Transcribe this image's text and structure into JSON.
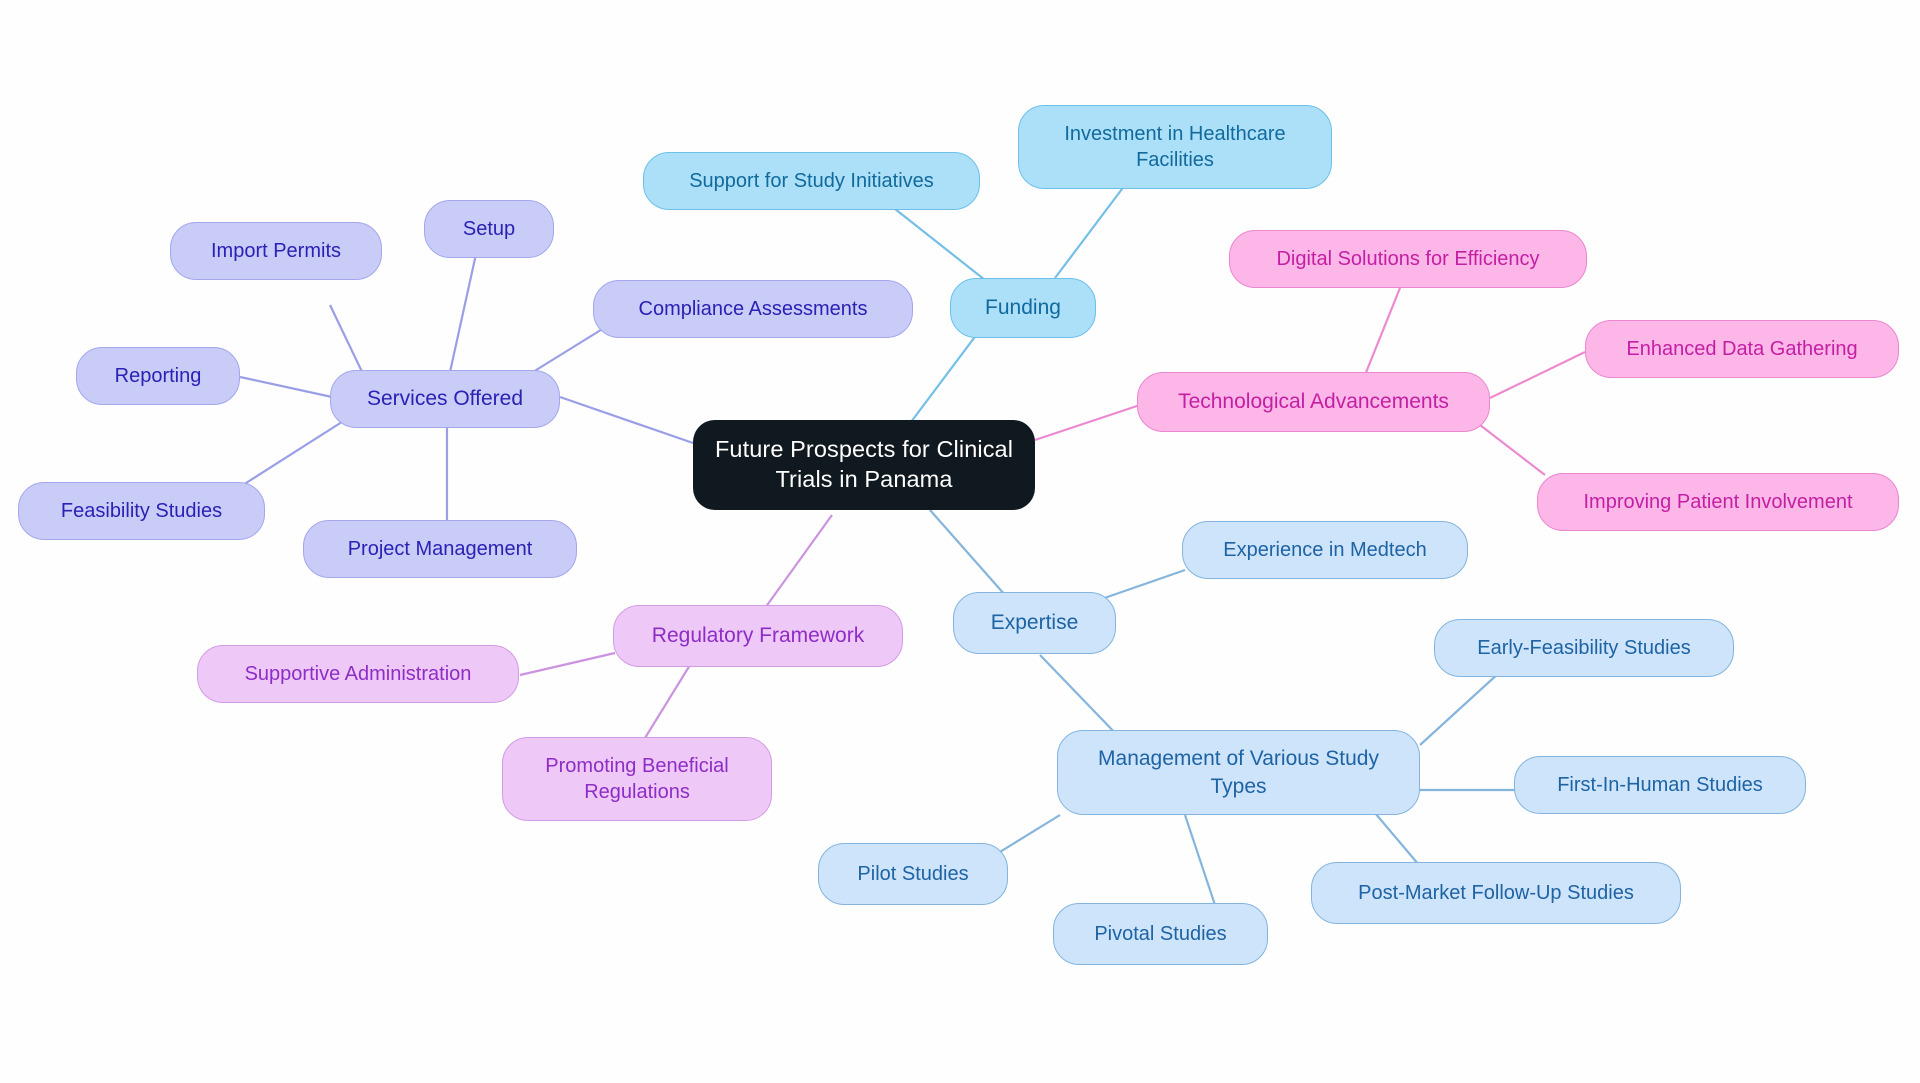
{
  "diagram": {
    "type": "mindmap",
    "title": "Future Prospects for Clinical Trials in Panama",
    "background_color": "#fefeff",
    "root": {
      "id": "root",
      "label": "Future Prospects for Clinical\nTrials in Panama",
      "fill": "#101820",
      "text_color": "#ffffff"
    },
    "branches": [
      {
        "id": "services-offered",
        "label": "Services Offered",
        "color_key": "indigo",
        "fill": "#c9ccf7",
        "border": "#a3a7ec",
        "text_color": "#2a21b5",
        "children": [
          {
            "id": "import-permits",
            "label": "Import Permits"
          },
          {
            "id": "setup",
            "label": "Setup"
          },
          {
            "id": "reporting",
            "label": "Reporting"
          },
          {
            "id": "compliance-assessments",
            "label": "Compliance Assessments"
          },
          {
            "id": "feasibility-studies",
            "label": "Feasibility Studies"
          },
          {
            "id": "project-management",
            "label": "Project Management"
          }
        ]
      },
      {
        "id": "funding",
        "label": "Funding",
        "color_key": "sky",
        "fill": "#ace0f9",
        "border": "#6cc0e8",
        "text_color": "#116a9b",
        "children": [
          {
            "id": "support-for-study-initiatives",
            "label": "Support for Study Initiatives"
          },
          {
            "id": "investment-in-healthcare-facilities",
            "label": "Investment in Healthcare\nFacilities"
          }
        ]
      },
      {
        "id": "technological-advancements",
        "label": "Technological Advancements",
        "color_key": "pink",
        "fill": "#fcb6e8",
        "border": "#ec86cf",
        "text_color": "#c41fa3",
        "children": [
          {
            "id": "digital-solutions-for-efficiency",
            "label": "Digital Solutions for Efficiency"
          },
          {
            "id": "enhanced-data-gathering",
            "label": "Enhanced Data Gathering"
          },
          {
            "id": "improving-patient-involvement",
            "label": "Improving Patient Involvement"
          }
        ]
      },
      {
        "id": "regulatory-framework",
        "label": "Regulatory Framework",
        "color_key": "violet",
        "fill": "#eec8f7",
        "border": "#d49be5",
        "text_color": "#8e2dc6",
        "children": [
          {
            "id": "supportive-administration",
            "label": "Supportive Administration"
          },
          {
            "id": "promoting-beneficial-regulations",
            "label": "Promoting Beneficial\nRegulations"
          }
        ]
      },
      {
        "id": "expertise",
        "label": "Expertise",
        "color_key": "paleblue",
        "fill": "#cde4fa",
        "border": "#84b4dd",
        "text_color": "#1e63a4",
        "children": [
          {
            "id": "experience-in-medtech",
            "label": "Experience in Medtech"
          },
          {
            "id": "management-of-various-study-types",
            "label": "Management of Various Study\nTypes",
            "children": [
              {
                "id": "early-feasibility-studies",
                "label": "Early-Feasibility Studies"
              },
              {
                "id": "first-in-human-studies",
                "label": "First-In-Human Studies"
              },
              {
                "id": "post-market-follow-up-studies",
                "label": "Post-Market Follow-Up Studies"
              },
              {
                "id": "pivotal-studies",
                "label": "Pivotal Studies"
              },
              {
                "id": "pilot-studies",
                "label": "Pilot Studies"
              }
            ]
          }
        ]
      }
    ],
    "nodes": {
      "root": {
        "label": "Future Prospects for Clinical\nTrials in Panama"
      },
      "services_offered": {
        "label": "Services Offered"
      },
      "import_permits": {
        "label": "Import Permits"
      },
      "setup": {
        "label": "Setup"
      },
      "reporting": {
        "label": "Reporting"
      },
      "compliance_assessments": {
        "label": "Compliance Assessments"
      },
      "feasibility_studies": {
        "label": "Feasibility Studies"
      },
      "project_management": {
        "label": "Project Management"
      },
      "funding": {
        "label": "Funding"
      },
      "support_for_study_initiatives": {
        "label": "Support for Study Initiatives"
      },
      "investment_in_healthcare_facilities": {
        "label": "Investment in Healthcare\nFacilities"
      },
      "technological_advancements": {
        "label": "Technological Advancements"
      },
      "digital_solutions_for_efficiency": {
        "label": "Digital Solutions for Efficiency"
      },
      "enhanced_data_gathering": {
        "label": "Enhanced Data Gathering"
      },
      "improving_patient_involvement": {
        "label": "Improving Patient Involvement"
      },
      "regulatory_framework": {
        "label": "Regulatory Framework"
      },
      "supportive_administration": {
        "label": "Supportive Administration"
      },
      "promoting_beneficial_regulations": {
        "label": "Promoting Beneficial\nRegulations"
      },
      "expertise": {
        "label": "Expertise"
      },
      "experience_in_medtech": {
        "label": "Experience in Medtech"
      },
      "management_of_various_study_types": {
        "label": "Management of Various Study\nTypes"
      },
      "early_feasibility_studies": {
        "label": "Early-Feasibility Studies"
      },
      "first_in_human_studies": {
        "label": "First-In-Human Studies"
      },
      "post_market_follow_up_studies": {
        "label": "Post-Market Follow-Up Studies"
      },
      "pivotal_studies": {
        "label": "Pivotal Studies"
      },
      "pilot_studies": {
        "label": "Pilot Studies"
      }
    }
  }
}
